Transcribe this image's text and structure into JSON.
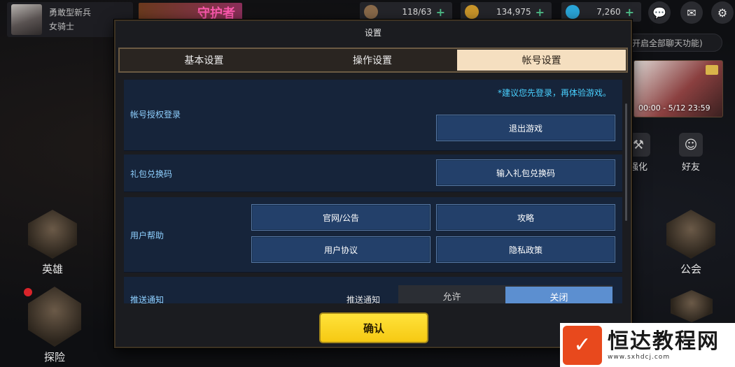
{
  "player": {
    "rank": "勇敢型新兵",
    "class": "女骑士"
  },
  "banner_text": "守护者",
  "resources": {
    "stamina": "118/63",
    "gold": "134,975",
    "gems": "7,260"
  },
  "chat_pill": "开启全部聊天功能)",
  "event": {
    "time": "00:00 - 5/12 23:59"
  },
  "side": {
    "enhance": "强化",
    "friends": "好友",
    "heroes": "英雄",
    "guild": "公会",
    "explore": "探险"
  },
  "settings": {
    "title": "设置",
    "tabs": [
      {
        "label": "基本设置",
        "active": false
      },
      {
        "label": "操作设置",
        "active": false
      },
      {
        "label": "帐号设置",
        "active": true
      }
    ],
    "account": {
      "label": "帐号授权登录",
      "hint": "*建议您先登录，再体验游戏。",
      "logout": "退出游戏"
    },
    "gift": {
      "label": "礼包兑换码",
      "button": "输入礼包兑换码"
    },
    "help": {
      "label": "用户帮助",
      "buttons": [
        "官网/公告",
        "攻略",
        "用户协议",
        "隐私政策"
      ]
    },
    "push": {
      "label": "推送通知",
      "sublabel": "推送通知",
      "allow": "允许",
      "off": "关闭",
      "selected": "关闭"
    },
    "confirm": "确认"
  },
  "watermark": {
    "name": "恒达教程网",
    "url": "www.sxhdcj.com"
  },
  "colors": {
    "accent_blue": "#5c8fd0",
    "confirm_yellow": "#f6c913",
    "hint_cyan": "#49d0ff",
    "tab_active": "#f5dfc0"
  }
}
